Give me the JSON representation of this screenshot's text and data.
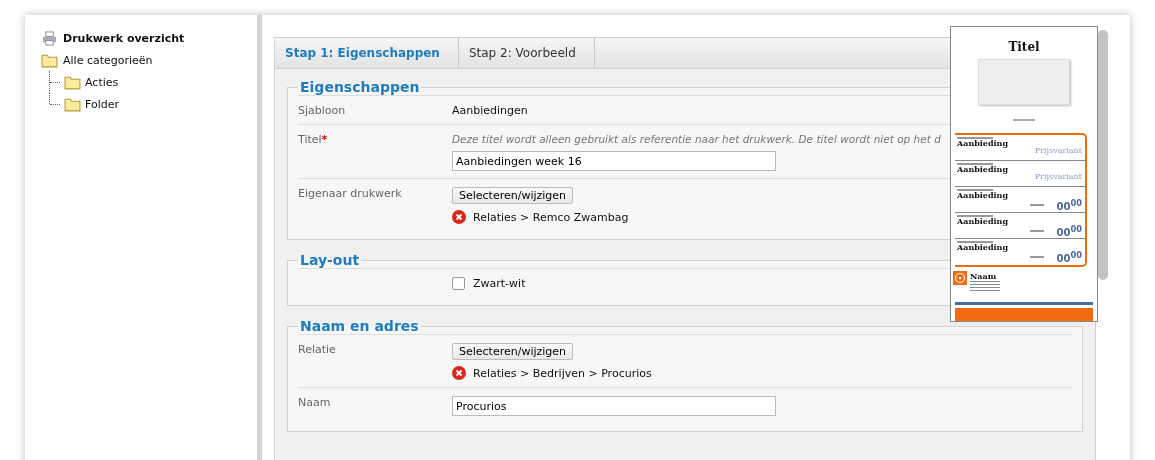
{
  "sidebar": {
    "root": {
      "label": "Drukwerk overzicht"
    },
    "tree": [
      {
        "label": "Alle categorieën",
        "children": [
          {
            "label": "Acties"
          },
          {
            "label": "Folder"
          }
        ]
      }
    ]
  },
  "steps": [
    {
      "label": "Stap 1: Eigenschappen",
      "selected": true
    },
    {
      "label": "Stap 2: Voorbeeld",
      "selected": false
    }
  ],
  "sections": [
    {
      "title": "Eigenschappen",
      "rows": [
        {
          "kind": "text",
          "label": "Sjabloon",
          "value": "Aanbiedingen"
        },
        {
          "kind": "input",
          "label": "Titel",
          "marker": "*",
          "hint": "Deze titel wordt alleen gebruikt als referentie naar het drukwerk. De titel wordt niet op het d",
          "value": "Aanbiedingen week 16"
        },
        {
          "kind": "select",
          "label": "Eigenaar drukwerk",
          "button": "Selecteren/wijzigen",
          "link": "Relaties > Remco Zwambag"
        }
      ]
    },
    {
      "title": "Lay-out",
      "rows": [
        {
          "kind": "checkbox",
          "label": "",
          "option": "Zwart-wit",
          "checked": false
        }
      ]
    },
    {
      "title": "Naam en adres",
      "rows": [
        {
          "kind": "select",
          "label": "Relatie",
          "button": "Selecteren/wijzigen",
          "link": "Relaties > Bedrijven > Procurios"
        },
        {
          "kind": "input",
          "label": "Naam",
          "value": "Procurios"
        }
      ]
    }
  ],
  "preview": {
    "title": "Titel",
    "offers": [
      {
        "kind": "variant",
        "name": "Aanbieding",
        "variant": "Prijsvariant"
      },
      {
        "kind": "variant",
        "name": "Aanbieding",
        "variant": "Prijsvariant"
      },
      {
        "kind": "price",
        "name": "Aanbieding",
        "price": "00",
        "cents": "00"
      },
      {
        "kind": "price",
        "name": "Aanbieding",
        "price": "00",
        "cents": "00"
      },
      {
        "kind": "price",
        "name": "Aanbieding",
        "price": "00",
        "cents": "00"
      }
    ],
    "contact": {
      "name": "Naam"
    }
  }
}
